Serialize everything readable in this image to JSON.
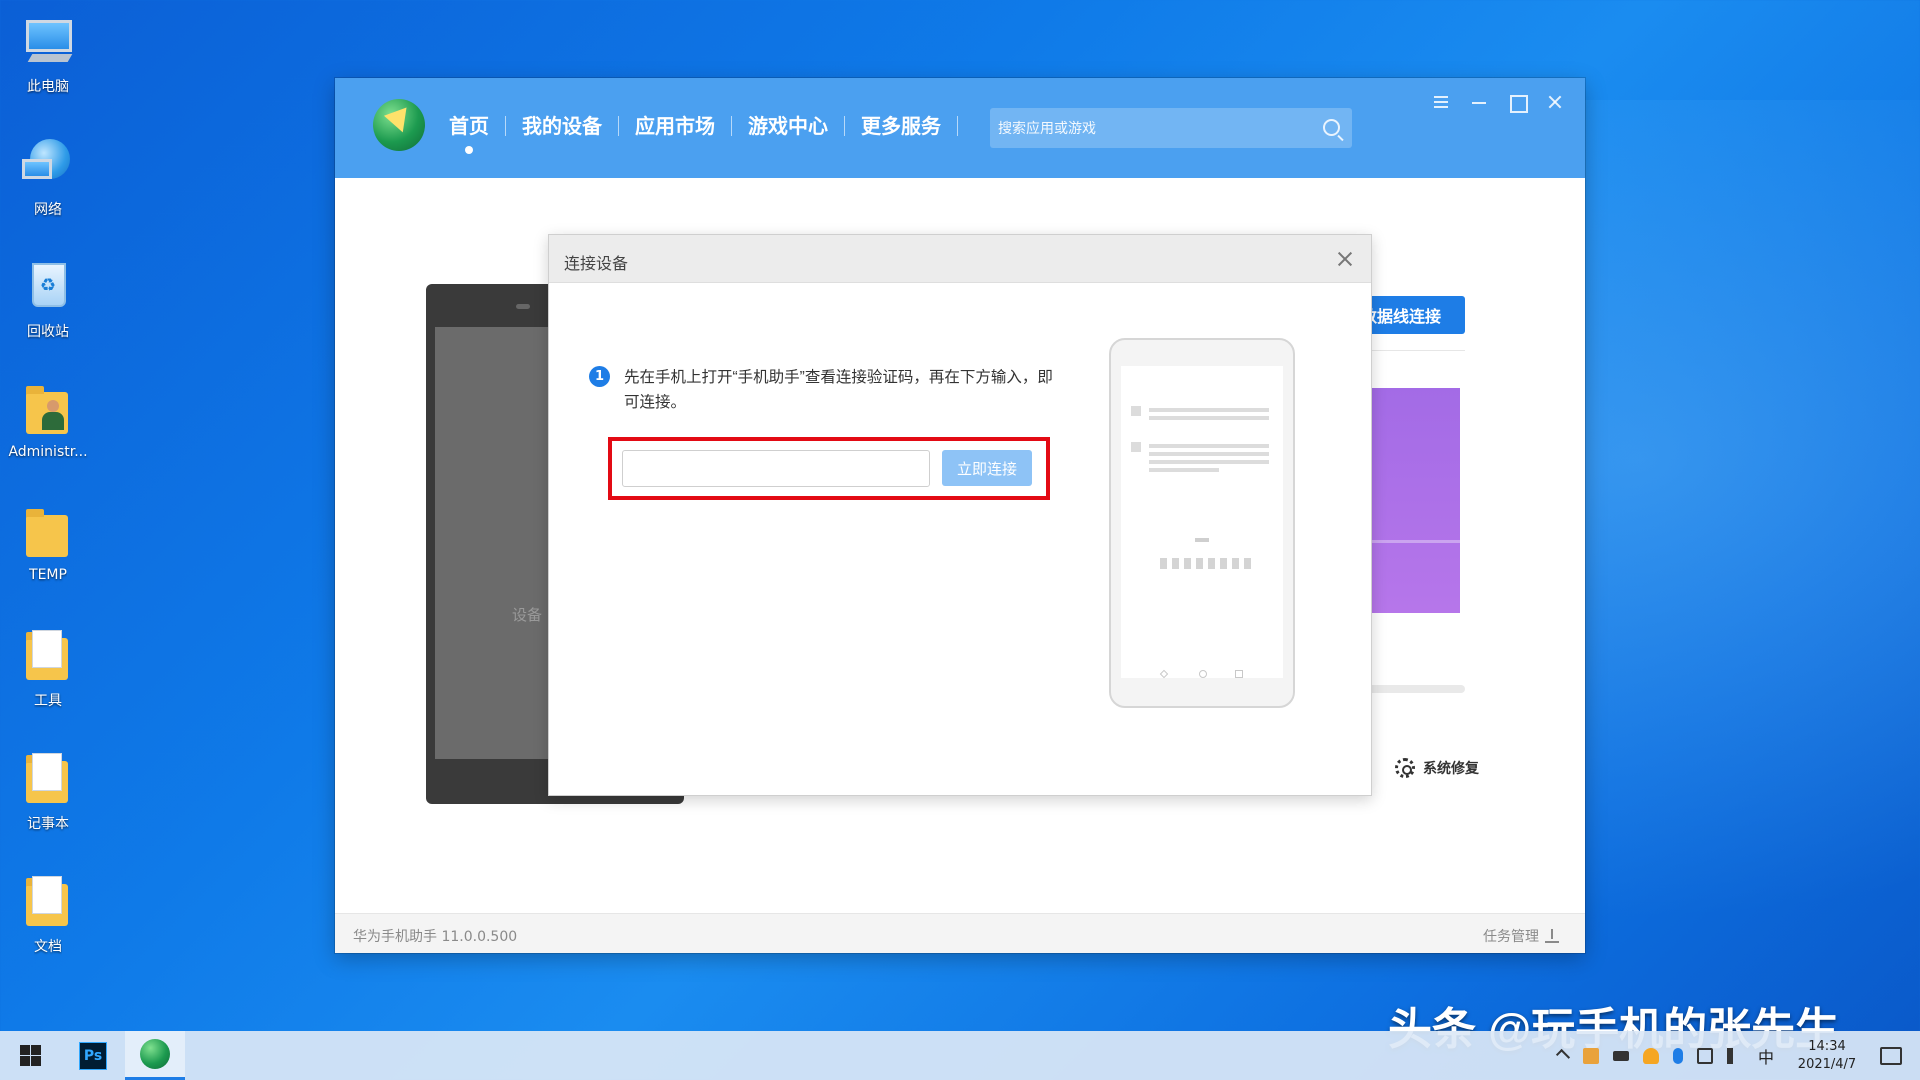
{
  "desktop": {
    "icons": [
      {
        "label": "此电脑",
        "icon": "computer-icon"
      },
      {
        "label": "网络",
        "icon": "network-icon"
      },
      {
        "label": "回收站",
        "icon": "recycle-bin-icon"
      },
      {
        "label": "Administr...",
        "icon": "user-folder-icon"
      },
      {
        "label": "TEMP",
        "icon": "folder-icon"
      },
      {
        "label": "工具",
        "icon": "folder-icon"
      },
      {
        "label": "记事本",
        "icon": "folder-icon"
      },
      {
        "label": "文档",
        "icon": "document-folder-icon"
      }
    ]
  },
  "app": {
    "nav": [
      {
        "label": "首页",
        "active": true
      },
      {
        "label": "我的设备"
      },
      {
        "label": "应用市场"
      },
      {
        "label": "游戏中心"
      },
      {
        "label": "更多服务"
      }
    ],
    "search": {
      "placeholder": "搜索应用或游戏"
    },
    "background": {
      "phone_text": "设备",
      "usb_button": "B数据线连接",
      "repair_label": "系统修复"
    },
    "status": {
      "version": "华为手机助手 11.0.0.500",
      "task_manager": "任务管理"
    },
    "brand_color": "#4ba0f0"
  },
  "modal": {
    "title": "连接设备",
    "step_number": "1",
    "instruction": "先在手机上打开“手机助手”查看连接验证码，再在下方输入，即可连接。",
    "code_input": {
      "value": "",
      "placeholder": ""
    },
    "connect_button": "立即连接",
    "highlight_color": "#e30a14"
  },
  "taskbar": {
    "apps": [
      {
        "name": "photoshop",
        "label": "Ps"
      },
      {
        "name": "huawei-hisuite",
        "active": true
      }
    ],
    "ime": "中",
    "time": "14:34",
    "date": "2021/4/7"
  },
  "watermark": "头条 @玩手机的张先生"
}
